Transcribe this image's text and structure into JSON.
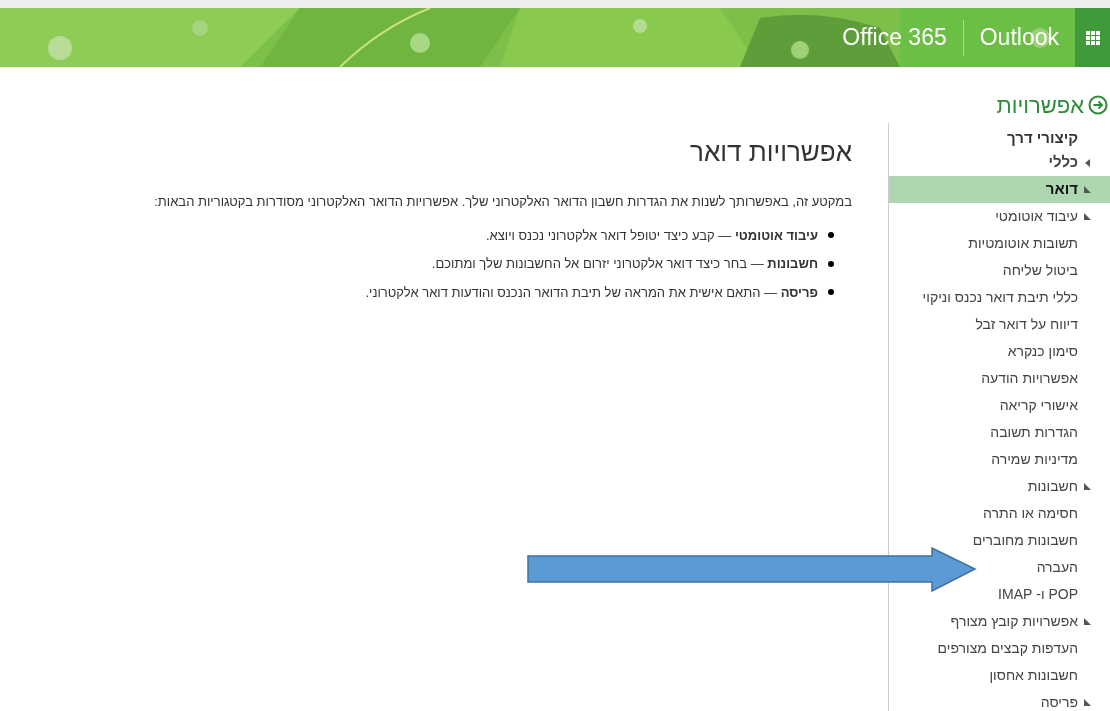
{
  "header": {
    "apps": [
      "Outlook",
      "Office 365"
    ]
  },
  "options_title": "אפשרויות",
  "sidebar": {
    "title": "קיצורי דרך",
    "items": [
      {
        "label": "כללי",
        "expanded": false,
        "selected": false
      },
      {
        "label": "דואר",
        "expanded": true,
        "selected": true,
        "children": [
          {
            "label": "עיבוד אוטומטי",
            "expanded": true,
            "selected": false,
            "children": [
              {
                "label": "תשובות אוטומטיות",
                "selected": false
              },
              {
                "label": "ביטול שליחה",
                "selected": false
              },
              {
                "label": "כללי תיבת דואר נכנס וניקוי",
                "selected": false
              },
              {
                "label": "דיווח על דואר זבל",
                "selected": false
              },
              {
                "label": "סימון כנקרא",
                "selected": false
              },
              {
                "label": "אפשרויות הודעה",
                "selected": false
              },
              {
                "label": "אישורי קריאה",
                "selected": false
              },
              {
                "label": "הגדרות תשובה",
                "selected": false
              },
              {
                "label": "מדיניות שמירה",
                "selected": false
              }
            ]
          },
          {
            "label": "חשבונות",
            "expanded": true,
            "selected": false,
            "children": [
              {
                "label": "חסימה או התרה",
                "selected": false
              },
              {
                "label": "חשבונות מחוברים",
                "selected": false
              },
              {
                "label": "העברה",
                "selected": false
              },
              {
                "label": "POP ו- IMAP",
                "selected": false
              }
            ]
          },
          {
            "label": "אפשרויות קובץ מצורף",
            "expanded": true,
            "selected": false,
            "children": [
              {
                "label": "העדפות קבצים מצורפים",
                "selected": false
              },
              {
                "label": "חשבונות אחסון",
                "selected": false
              }
            ]
          },
          {
            "label": "פריסה",
            "expanded": true,
            "selected": false
          }
        ]
      }
    ]
  },
  "content": {
    "title": "אפשרויות דואר",
    "intro": "במקטע זה, באפשרותך לשנות את הגדרות חשבון הדואר האלקטרוני שלך. אפשרויות הדואר האלקטרוני מסודרות בקטגוריות הבאות:",
    "bullets": [
      "**עיבוד אוטומטי** — קבע כיצד יטופל דואר אלקטרוני נכנס ויוצא.",
      "**חשבונות** — בחר כיצד דואר אלקטרוני יזרום אל החשבונות שלך ומתוכם.",
      "**פריסה** — התאם אישית את המראה של תיבת הדואר הנכנס והודעות דואר אלקטרוני."
    ]
  }
}
